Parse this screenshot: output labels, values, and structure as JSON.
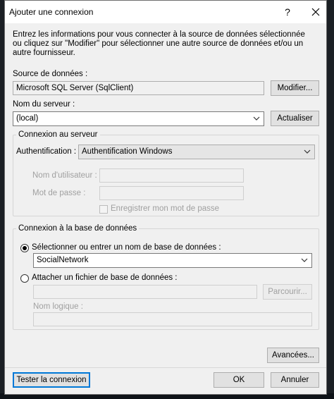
{
  "window": {
    "title": "Ajouter une connexion",
    "help_label": "?",
    "close_icon": "close-icon"
  },
  "intro": {
    "text": "Entrez les informations pour vous connecter à la source de données sélectionnée ou cliquez sur \"Modifier\" pour sélectionner une autre source de données et/ou un autre fournisseur."
  },
  "data_source": {
    "label": "Source de données :",
    "value": "Microsoft SQL Server (SqlClient)",
    "modify_label": "Modifier..."
  },
  "server": {
    "label": "Nom du serveur :",
    "value": "(local)",
    "refresh_label": "Actualiser"
  },
  "server_connection": {
    "group_title": "Connexion au serveur",
    "auth_label": "Authentification :",
    "auth_value": "Authentification Windows",
    "username_label": "Nom d'utilisateur :",
    "username_value": "",
    "password_label": "Mot de passe :",
    "password_value": "",
    "save_password_label": "Enregistrer mon mot de passe",
    "save_password_checked": false
  },
  "db_connection": {
    "group_title": "Connexion à la base de données",
    "option_select_label": "Sélectionner ou entrer un nom de base de données :",
    "option_select_checked": true,
    "db_name_value": "SocialNetwork",
    "option_attach_label": "Attacher un fichier de base de données :",
    "option_attach_checked": false,
    "attach_file_value": "",
    "browse_label": "Parcourir...",
    "logical_name_label": "Nom logique :",
    "logical_name_value": ""
  },
  "footer": {
    "advanced_label": "Avancées...",
    "test_label": "Tester la connexion",
    "ok_label": "OK",
    "cancel_label": "Annuler"
  },
  "colors": {
    "accent": "#0078d7",
    "dialog_bg": "#f0f0f0"
  }
}
